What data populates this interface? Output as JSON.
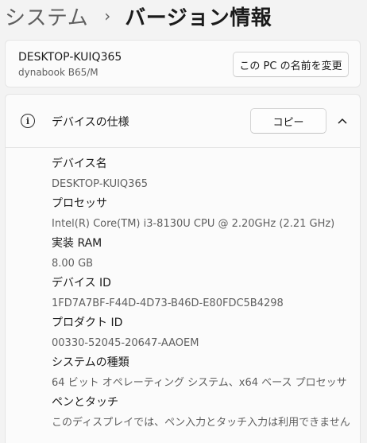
{
  "breadcrumb": {
    "parent": "システム",
    "separator": "›",
    "current": "バージョン情報"
  },
  "device": {
    "name": "DESKTOP-KUIQ365",
    "model": "dynabook B65/M",
    "rename_label": "この PC の名前を変更"
  },
  "specs": {
    "title": "デバイスの仕様",
    "copy_label": "コピー",
    "items": [
      {
        "label": "デバイス名",
        "value": "DESKTOP-KUIQ365"
      },
      {
        "label": "プロセッサ",
        "value": "Intel(R) Core(TM) i3-8130U CPU @ 2.20GHz (2.21 GHz)"
      },
      {
        "label": "実装 RAM",
        "value": "8.00 GB"
      },
      {
        "label": "デバイス ID",
        "value": "1FD7A7BF-F44D-4D73-B46D-E80FDC5B4298"
      },
      {
        "label": "プロダクト ID",
        "value": "00330-52045-20647-AAOEM"
      },
      {
        "label": "システムの種類",
        "value": "64 ビット オペレーティング システム、x64 ベース プロセッサ"
      },
      {
        "label": "ペンとタッチ",
        "value": "このディスプレイでは、ペン入力とタッチ入力は利用できません"
      }
    ]
  },
  "icons": {
    "info": "info-circle-icon",
    "collapse": "chevron-up-icon"
  },
  "colors": {
    "background": "#f3f3f3",
    "card": "#fbfbfb",
    "secondary_text": "#5f5f5f"
  }
}
